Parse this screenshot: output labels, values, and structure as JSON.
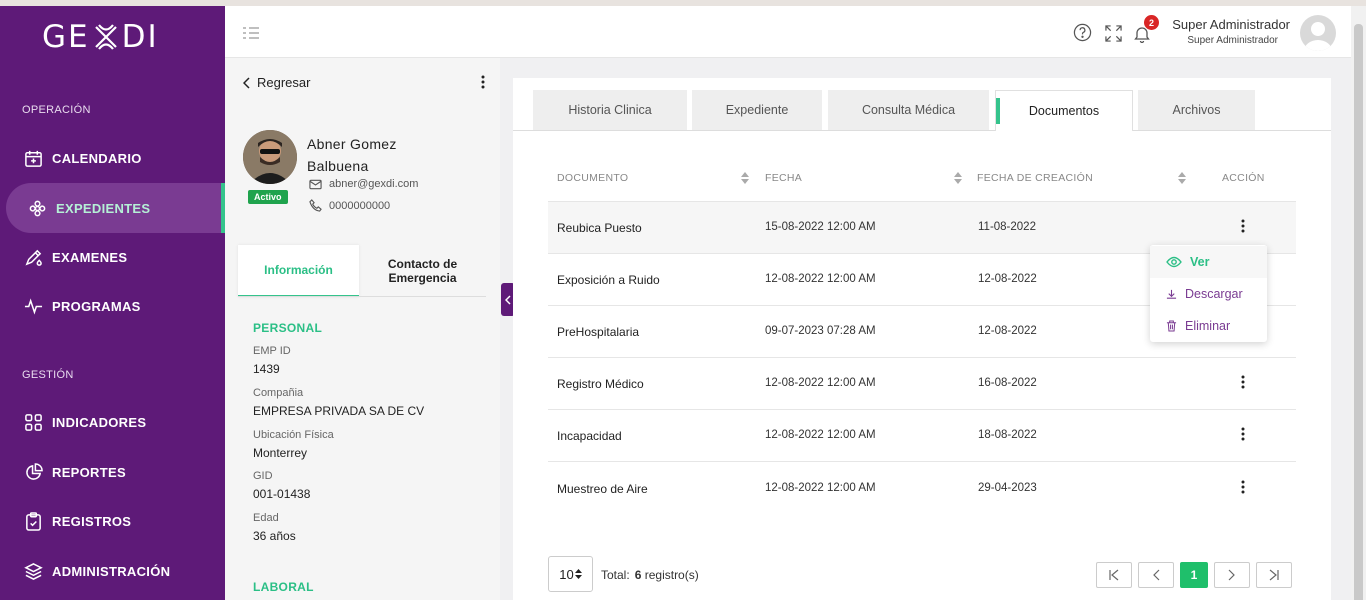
{
  "app": {
    "logo": "GE",
    "logo_end": "DI"
  },
  "sidebar": {
    "section_operacion": "OPERACIÓN",
    "section_gestion": "GESTIÓN",
    "items": [
      {
        "label": "CALENDARIO",
        "icon": "calendar-icon"
      },
      {
        "label": "EXPEDIENTES",
        "icon": "medical-flower-icon",
        "active": true
      },
      {
        "label": "EXAMENES",
        "icon": "pen-drop-icon"
      },
      {
        "label": "PROGRAMAS",
        "icon": "pulse-icon"
      },
      {
        "label": "INDICADORES",
        "icon": "grid-icon"
      },
      {
        "label": "REPORTES",
        "icon": "pie-chart-icon"
      },
      {
        "label": "REGISTROS",
        "icon": "clipboard-icon"
      },
      {
        "label": "ADMINISTRACIÓN",
        "icon": "layers-icon"
      }
    ]
  },
  "header": {
    "notification_count": "2",
    "user_name": "Super Administrador",
    "user_role": "Super Administrador"
  },
  "profile": {
    "back_label": "Regresar",
    "name": "Abner Gomez Balbuena",
    "status": "Activo",
    "email": "abner@gexdi.com",
    "phone": "0000000000",
    "tabs": [
      "Información",
      "Contacto de Emergencia"
    ],
    "section_personal": "PERSONAL",
    "fields": [
      {
        "label": "EMP ID",
        "value": "1439"
      },
      {
        "label": "Compañia",
        "value": "EMPRESA PRIVADA SA DE CV"
      },
      {
        "label": "Ubicación Física",
        "value": "Monterrey"
      },
      {
        "label": "GID",
        "value": "001-01438"
      },
      {
        "label": "Edad",
        "value": "36 años"
      }
    ],
    "section_laboral": "LABORAL"
  },
  "main": {
    "tabs": [
      "Historia Clinica",
      "Expediente",
      "Consulta Médica",
      "Documentos",
      "Archivos"
    ],
    "active_tab": "Documentos",
    "columns": [
      "DOCUMENTO",
      "FECHA",
      "FECHA DE CREACIÓN",
      "ACCIÓN"
    ],
    "rows": [
      {
        "documento": "Reubica Puesto",
        "fecha": "15-08-2022 12:00 AM",
        "creacion": "11-08-2022"
      },
      {
        "documento": "Exposición a Ruido",
        "fecha": "12-08-2022 12:00 AM",
        "creacion": "12-08-2022"
      },
      {
        "documento": "PreHospitalaria",
        "fecha": "09-07-2023 07:28 AM",
        "creacion": "12-08-2022"
      },
      {
        "documento": "Registro Médico",
        "fecha": "12-08-2022 12:00 AM",
        "creacion": "16-08-2022"
      },
      {
        "documento": "Incapacidad",
        "fecha": "12-08-2022 12:00 AM",
        "creacion": "18-08-2022"
      },
      {
        "documento": "Muestreo de Aire",
        "fecha": "12-08-2022 12:00 AM",
        "creacion": "29-04-2023"
      }
    ],
    "action_menu": [
      "Ver",
      "Descargar",
      "Eliminar"
    ],
    "per_page": "10",
    "total_label": "Total:",
    "total_count": "6",
    "total_unit": "registro(s)",
    "current_page": "1"
  }
}
